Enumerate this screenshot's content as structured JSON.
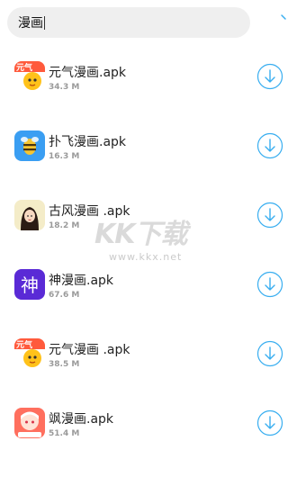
{
  "search": {
    "query": "漫画"
  },
  "colors": {
    "accent": "#39aef0"
  },
  "apps": [
    {
      "name": "元气漫画.apk",
      "size": "34.3 M",
      "icon": "yuanqi-manhua-icon"
    },
    {
      "name": "扑飞漫画.apk",
      "size": "16.3 M",
      "icon": "pufei-manhua-icon"
    },
    {
      "name": "古风漫画 .apk",
      "size": "18.2 M",
      "icon": "gufeng-manhua-icon"
    },
    {
      "name": "神漫画.apk",
      "size": "67.6 M",
      "icon": "shen-manhua-icon"
    },
    {
      "name": "元气漫画 .apk",
      "size": "38.5 M",
      "icon": "yuanqi-manhua-icon"
    },
    {
      "name": "飒漫画.apk",
      "size": "51.4 M",
      "icon": "sa-manhua-icon"
    }
  ],
  "watermark": {
    "logo": "KK下载",
    "url": "www.kkx.net"
  }
}
